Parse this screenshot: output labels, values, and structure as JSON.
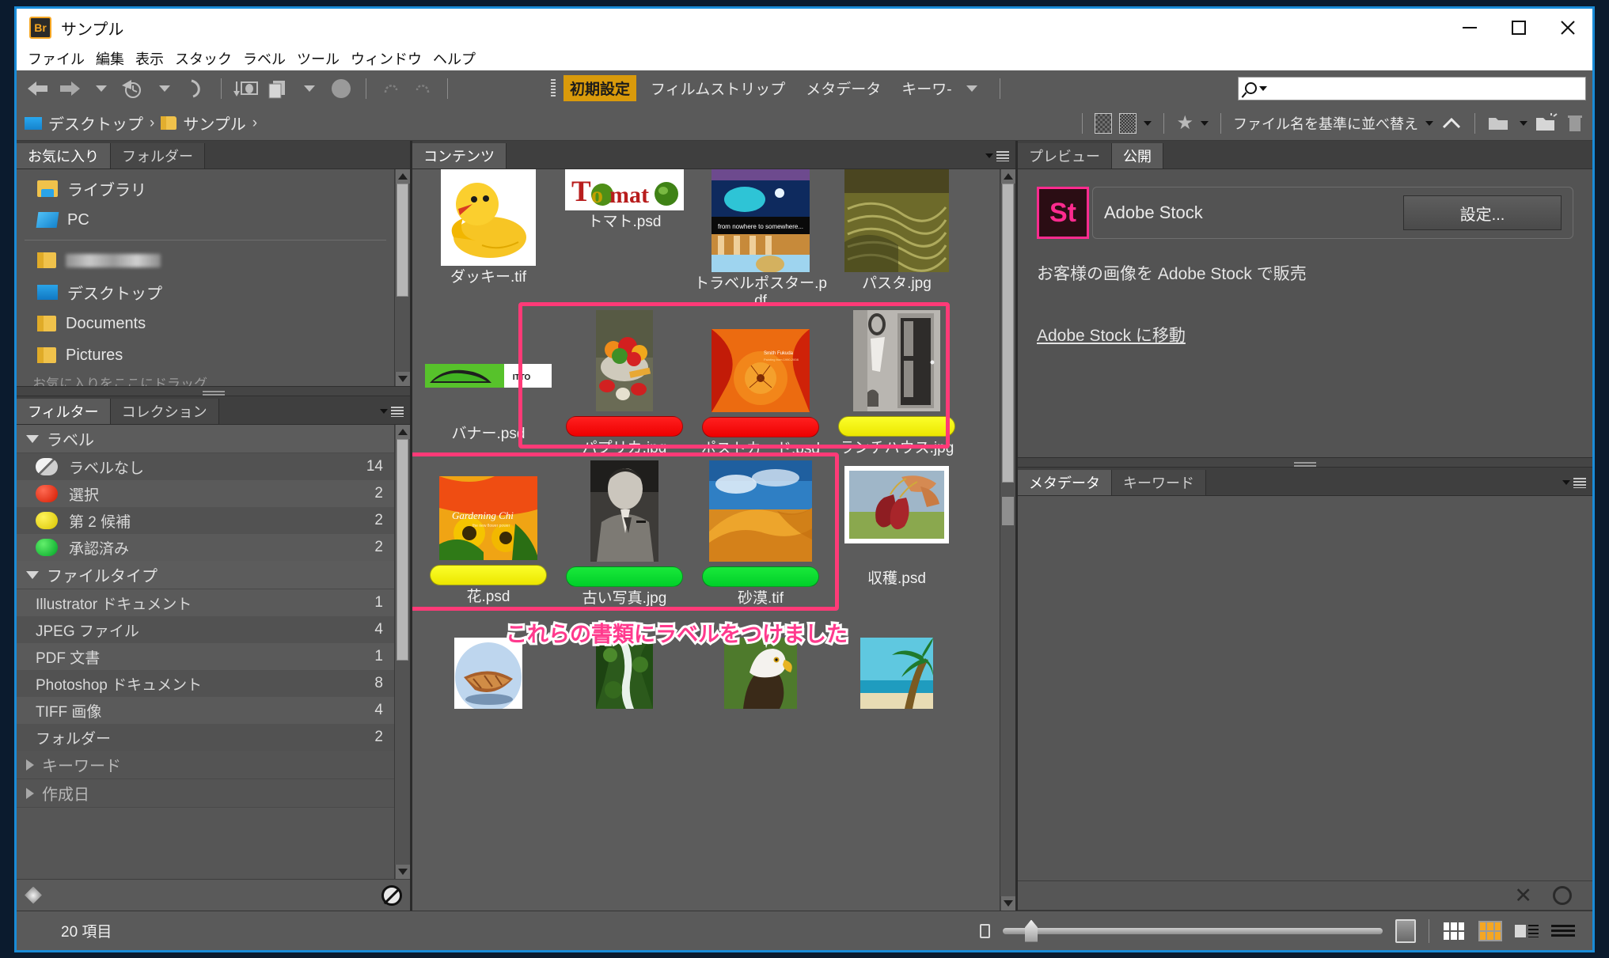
{
  "window": {
    "app_icon": "Br",
    "title": "サンプル",
    "minimize": "—",
    "maximize": "▢",
    "close": "✕"
  },
  "menubar": {
    "items": [
      "ファイル",
      "編集",
      "表示",
      "スタック",
      "ラベル",
      "ツール",
      "ウィンドウ",
      "ヘルプ"
    ]
  },
  "toolbar": {
    "workspaces": [
      {
        "label": "初期設定",
        "active": true
      },
      {
        "label": "フィルムストリップ",
        "active": false
      },
      {
        "label": "メタデータ",
        "active": false
      },
      {
        "label": "キーワ-",
        "active": false
      }
    ],
    "search_placeholder": "",
    "search_value": ""
  },
  "pathbar": {
    "crumbs": [
      "デスクトップ",
      "サンプル"
    ],
    "separator": "›",
    "sort_label": "ファイル名を基準に並べ替え"
  },
  "left": {
    "favorites_panel": {
      "tabs": [
        {
          "label": "お気に入り",
          "active": true
        },
        {
          "label": "フォルダー",
          "active": false
        }
      ],
      "items": [
        {
          "label": "ライブラリ",
          "icon": "library-icon"
        },
        {
          "label": "PC",
          "icon": "pc-icon"
        },
        {
          "label": "",
          "icon": "folder-icon",
          "blurred": true
        },
        {
          "label": "デスクトップ",
          "icon": "desktop-icon"
        },
        {
          "label": "Documents",
          "icon": "folder-icon"
        },
        {
          "label": "Pictures",
          "icon": "folder-icon"
        }
      ],
      "hint": "お気に入りをここにドラッグ..."
    },
    "filter_panel": {
      "tabs": [
        {
          "label": "フィルター",
          "active": true
        },
        {
          "label": "コレクション",
          "active": false
        }
      ],
      "sections": [
        {
          "title": "ラベル",
          "expanded": true,
          "rows": [
            {
              "label": "ラベルなし",
              "count": "14",
              "swatch": "none"
            },
            {
              "label": "選択",
              "count": "2",
              "swatch": "red"
            },
            {
              "label": "第 2 候補",
              "count": "2",
              "swatch": "yellow"
            },
            {
              "label": "承認済み",
              "count": "2",
              "swatch": "green"
            }
          ]
        },
        {
          "title": "ファイルタイプ",
          "expanded": true,
          "rows": [
            {
              "label": "Illustrator ドキュメント",
              "count": "1"
            },
            {
              "label": "JPEG ファイル",
              "count": "4"
            },
            {
              "label": "PDF 文書",
              "count": "1"
            },
            {
              "label": "Photoshop ドキュメント",
              "count": "8"
            },
            {
              "label": "TIFF 画像",
              "count": "4"
            },
            {
              "label": "フォルダー",
              "count": "2"
            }
          ]
        },
        {
          "title": "キーワード",
          "expanded": false,
          "rows": []
        },
        {
          "title": "作成日",
          "expanded": false,
          "rows": []
        }
      ]
    }
  },
  "content": {
    "tabs": [
      {
        "label": "コンテンツ",
        "active": true
      }
    ],
    "annotation": "これらの書類にラベルをつけました",
    "files": [
      {
        "name": "ダッキー.tif",
        "label": "none",
        "thumb": "duck"
      },
      {
        "name": "トマト.psd",
        "label": "none",
        "thumb": "tomato"
      },
      {
        "name": "トラベルポスター.pdf",
        "label": "none",
        "thumb": "travel"
      },
      {
        "name": "パスタ.jpg",
        "label": "none",
        "thumb": "pasta"
      },
      {
        "name": "バナー.psd",
        "label": "none",
        "thumb": "banner"
      },
      {
        "name": "パプリカ.jpg",
        "label": "red",
        "thumb": "peppers"
      },
      {
        "name": "ポストカード.psd",
        "label": "red",
        "thumb": "postcard"
      },
      {
        "name": "ランチハウス.jpg",
        "label": "yellow",
        "thumb": "ranchhouse"
      },
      {
        "name": "花.psd",
        "label": "yellow",
        "thumb": "flower"
      },
      {
        "name": "古い写真.jpg",
        "label": "green",
        "thumb": "oldphoto"
      },
      {
        "name": "砂漠.tif",
        "label": "green",
        "thumb": "desert"
      },
      {
        "name": "収穫.psd",
        "label": "none",
        "thumb": "harvest"
      },
      {
        "name": "",
        "label": "none",
        "thumb": "boat"
      },
      {
        "name": "",
        "label": "none",
        "thumb": "waterfall"
      },
      {
        "name": "",
        "label": "none",
        "thumb": "eagle"
      },
      {
        "name": "",
        "label": "none",
        "thumb": "palm"
      }
    ]
  },
  "right": {
    "publish_panel": {
      "tabs": [
        {
          "label": "プレビュー",
          "active": false
        },
        {
          "label": "公開",
          "active": true
        }
      ],
      "stock_badge": "St",
      "stock_name": "Adobe Stock",
      "settings_button": "設定...",
      "description": "お客様の画像を Adobe Stock で販売",
      "link": "Adobe Stock に移動"
    },
    "metadata_panel": {
      "tabs": [
        {
          "label": "メタデータ",
          "active": true
        },
        {
          "label": "キーワード",
          "active": false
        }
      ]
    }
  },
  "statusbar": {
    "item_count": "20 項目",
    "zoom_value": 6
  },
  "colors": {
    "accent": "#d99a0b",
    "highlight": "#ff3a77",
    "annotation": "#ff3a8d",
    "label_red": "#ee0000",
    "label_yellow": "#ece600",
    "label_green": "#00cf29",
    "stock_pink": "#ff2b8f"
  }
}
